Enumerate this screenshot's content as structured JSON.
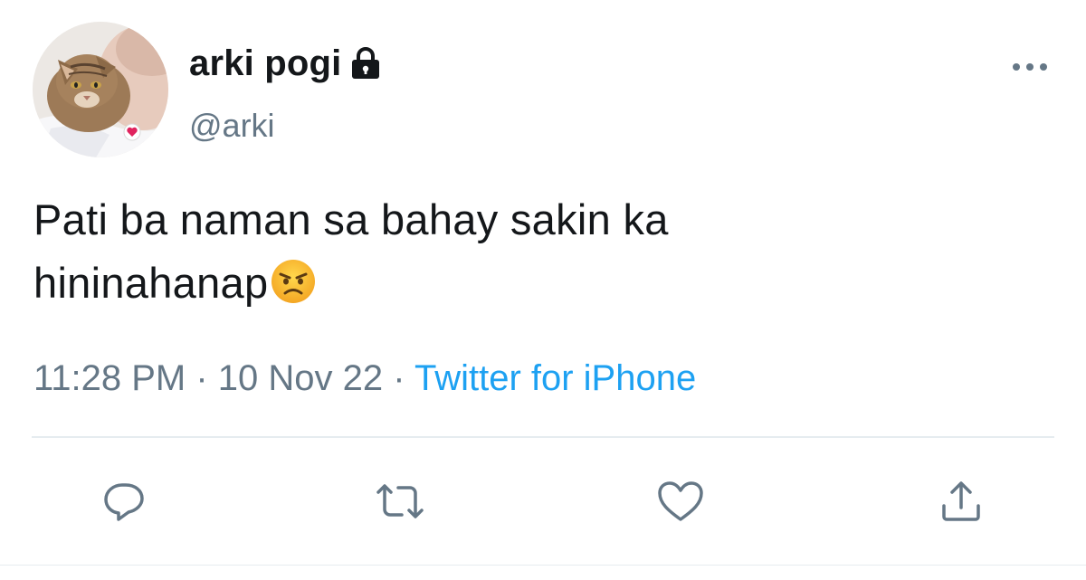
{
  "user": {
    "display_name": "arki pogi",
    "handle": "@arki",
    "avatar": "avatar-cat-photo",
    "protected_icon": "lock-icon"
  },
  "tweet": {
    "text_line1": "Pati ba naman sa bahay sakin ka",
    "text_line2": "hininahanap",
    "emoji": "angry-face-emoji"
  },
  "meta": {
    "time": "11:28 PM",
    "separator1": " · ",
    "date": "10 Nov 22",
    "separator2": " · ",
    "source": "Twitter for iPhone"
  },
  "actions": [
    {
      "name": "reply",
      "icon": "reply-icon"
    },
    {
      "name": "retweet",
      "icon": "retweet-icon"
    },
    {
      "name": "like",
      "icon": "heart-icon"
    },
    {
      "name": "share",
      "icon": "share-icon"
    }
  ],
  "colors": {
    "text": "#14171a",
    "secondary": "#657786",
    "link": "#1da1f2",
    "divider": "#e6ecf0"
  }
}
